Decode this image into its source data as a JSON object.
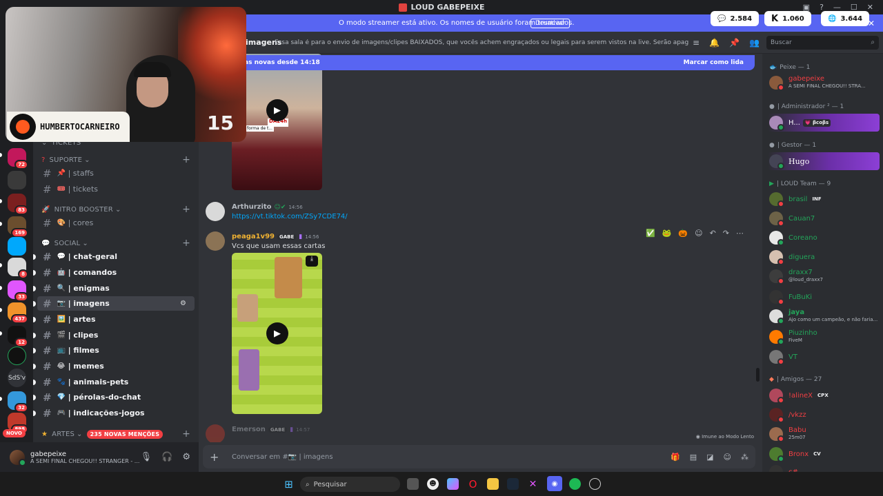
{
  "window": {
    "title": "LOUD GABEPEIXE"
  },
  "streamer_banner": {
    "text": "O modo streamer está ativo. Os nomes de usuário foram truncados.",
    "button": "Desativar",
    "counters": [
      {
        "icon": "chat-bubble-icon",
        "value": "2.584"
      },
      {
        "icon": "kick-k-icon",
        "value": "1.060"
      },
      {
        "icon": "globe-icon",
        "value": "3.644"
      }
    ]
  },
  "webcam": {
    "name": "HUMBERTOCARNEIRO",
    "number": "15"
  },
  "server_rail": {
    "badges": [
      "72",
      "83",
      "169",
      "8",
      "33",
      "437",
      "12",
      "32",
      "898"
    ],
    "text_servers": [
      "SdS'v"
    ],
    "novo": "NOVO"
  },
  "sidebar": {
    "categories": {
      "tickets": "TICKETS",
      "suporte": "SUPORTE",
      "nitro": "NITRO BOOSTER",
      "social": "SOCIAL",
      "artes": "ARTES",
      "artes_mentions": "235 NOVAS MENÇÕES"
    },
    "suporte_channels": [
      {
        "emoji": "📌",
        "label": "| staffs"
      },
      {
        "emoji": "🎟️",
        "label": "| tickets"
      }
    ],
    "nitro_channels": [
      {
        "emoji": "🎨",
        "label": "| cores"
      }
    ],
    "social_channels": [
      {
        "emoji": "💬",
        "label": "| chat-geral"
      },
      {
        "emoji": "🤖",
        "label": "| comandos"
      },
      {
        "emoji": "🔍",
        "label": "| enigmas"
      },
      {
        "emoji": "📷",
        "label": "| imagens"
      },
      {
        "emoji": "🖼️",
        "label": "| artes"
      },
      {
        "emoji": "🎬",
        "label": "| clipes"
      },
      {
        "emoji": "📺",
        "label": "| filmes"
      },
      {
        "emoji": "😂",
        "label": "| memes"
      },
      {
        "emoji": "🐾",
        "label": "| animais-pets"
      },
      {
        "emoji": "💎",
        "label": "| pérolas-do-chat"
      },
      {
        "emoji": "🎮",
        "label": "| indicações-jogos"
      }
    ]
  },
  "user_panel": {
    "name": "gabepeixe",
    "status": "A SEMI FINAL CHEGOU!! STRANGER - ..."
  },
  "channel_header": {
    "name": "imagens",
    "topic": "Essa sala é para o envio de imagens/clipes BAIXADOS, que vocês achem engraçados ou legais para serem vistos na live. Serão apagados prints de o...",
    "search_placeholder": "Buscar"
  },
  "new_messages_bar": {
    "left": "as novas desde 14:18",
    "right": "Marcar como lida"
  },
  "messages": [
    {
      "author": "Arthurzito",
      "time": "14:56",
      "text": "https://vt.tiktok.com/ZSy7CDE74/"
    },
    {
      "author": "peaga1v99",
      "tag": "GABE",
      "time": "14:56",
      "text": "Vcs que usam essas cartas"
    },
    {
      "author": "Emerson",
      "tag": "GABE",
      "time": "14:57",
      "text": ""
    }
  ],
  "video_overlay_text": {
    "top": "DA24h",
    "caption": "forma de t..."
  },
  "slow_mode": "Imune ao Modo Lento",
  "composer": {
    "placeholder": "Conversar em #📷 | imagens"
  },
  "members": {
    "groups": [
      {
        "label": "Peixe — 1"
      },
      {
        "label": "| Administrador ² — 1"
      },
      {
        "label": "| Gestor — 1"
      },
      {
        "label": "| LOUD Team — 9"
      },
      {
        "label": "| Amigos — 27"
      }
    ],
    "list": [
      {
        "name": "gabepeixe",
        "status": "A SEMI FINAL CHEGOU!! STRA..."
      },
      {
        "name": "H...",
        "tag": "💗 βcoβs"
      },
      {
        "name": "Hugo",
        "tag": ""
      },
      {
        "name": "brasil",
        "tag": "INF"
      },
      {
        "name": "Cauan7",
        "status": ""
      },
      {
        "name": "Coreano",
        "status": ""
      },
      {
        "name": "diguera",
        "status": ""
      },
      {
        "name": "draxx7",
        "status": "@loud_draxx7"
      },
      {
        "name": "FuBuKi",
        "status": ""
      },
      {
        "name": "jaya",
        "status": "Ajo como um campeão, e não faria..."
      },
      {
        "name": "Piuzinho",
        "status": "FiveM"
      },
      {
        "name": "VT",
        "status": ""
      },
      {
        "name": "!alineX",
        "tag": "CPX"
      },
      {
        "name": "/vkzz",
        "status": ""
      },
      {
        "name": "Babu",
        "status": "25m07"
      },
      {
        "name": "Bronx",
        "tag": "CV"
      },
      {
        "name": "c#",
        "status": ""
      }
    ]
  },
  "taskbar": {
    "search_placeholder": "Pesquisar"
  },
  "colors": {
    "blurple": "#5865f2",
    "background": "#313338",
    "sidebar": "#2b2d31",
    "rail": "#1e1f22",
    "danger": "#f23f43",
    "online": "#23a55a"
  }
}
